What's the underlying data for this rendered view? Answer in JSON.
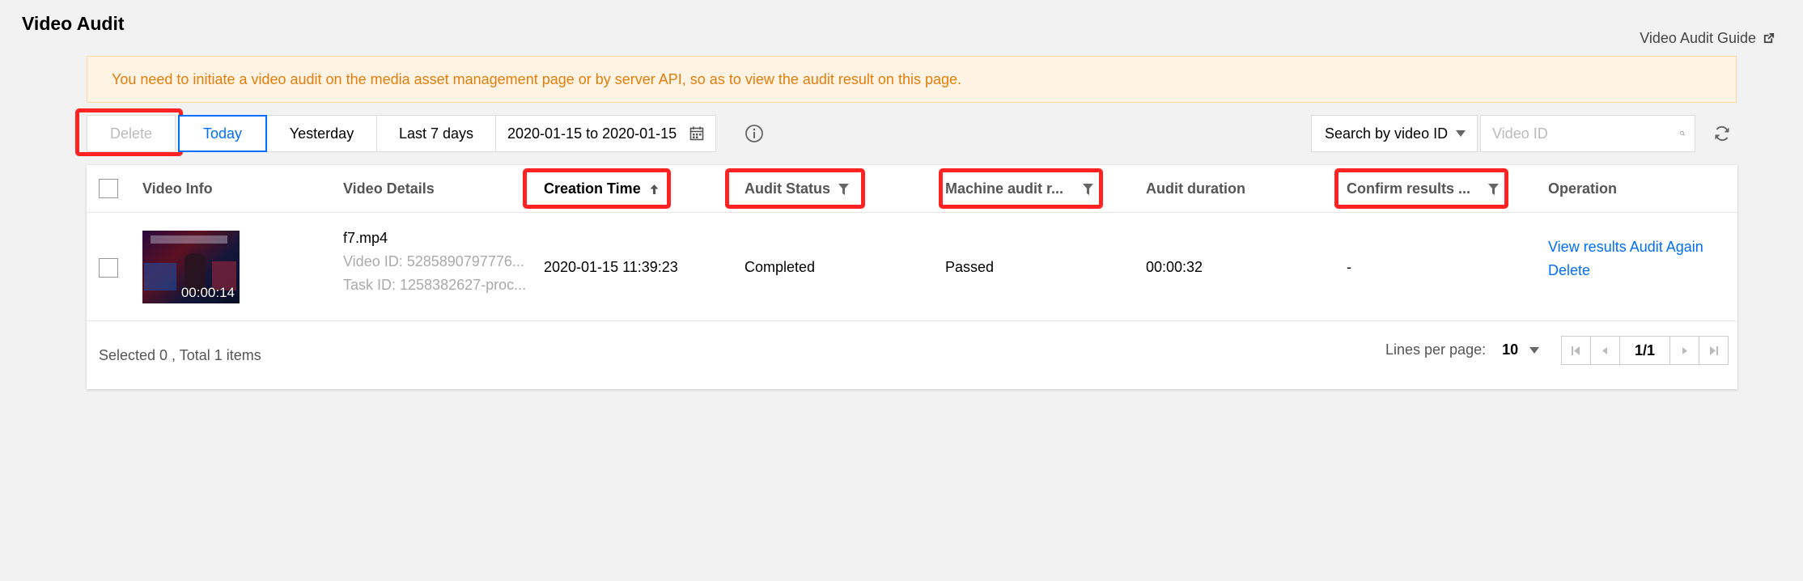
{
  "page": {
    "title": "Video Audit",
    "guide_link": "Video Audit Guide"
  },
  "notice": {
    "text": "You need to initiate a video audit on the media asset management page or by server API, so as to view the audit result on this page."
  },
  "toolbar": {
    "delete_label": "Delete",
    "today_label": "Today",
    "yesterday_label": "Yesterday",
    "last7_label": "Last 7 days",
    "date_range": "2020-01-15 to 2020-01-15"
  },
  "search": {
    "type_label": "Search by video ID",
    "placeholder": "Video ID",
    "value": ""
  },
  "table": {
    "headers": {
      "video_info": "Video Info",
      "video_details": "Video Details",
      "creation_time": "Creation Time",
      "audit_status": "Audit Status",
      "machine_audit": "Machine audit r...",
      "audit_duration": "Audit duration",
      "confirm_results": "Confirm results ...",
      "operation": "Operation"
    },
    "rows": [
      {
        "thumb_duration": "00:00:14",
        "file_name": "f7.mp4",
        "video_id": "Video ID: 5285890797776...",
        "task_id": "Task ID: 1258382627-proc...",
        "creation_time": "2020-01-15 11:39:23",
        "audit_status": "Completed",
        "machine_audit": "Passed",
        "audit_duration": "00:00:32",
        "confirm_results": "-",
        "op_view": "View results",
        "op_audit_again": "Audit Again",
        "op_delete": "Delete"
      }
    ]
  },
  "footer": {
    "selected_text": "Selected 0 , Total 1 items",
    "lines_per_page_label": "Lines per page:",
    "lines_per_page_value": "10",
    "page_indicator": "1/1"
  },
  "colors": {
    "accent": "#006eff",
    "notice_text": "#e37d0e",
    "highlight": "#ff2323"
  }
}
